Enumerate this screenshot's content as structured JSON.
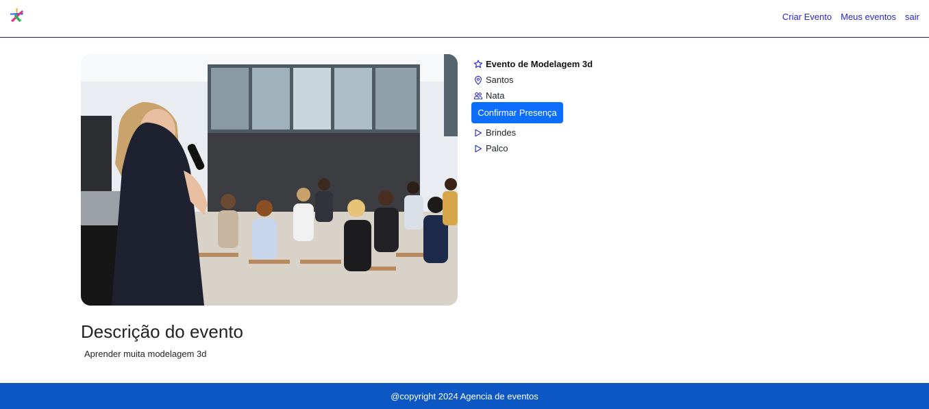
{
  "nav": {
    "links": [
      "Criar Evento",
      "Meus eventos",
      "sair"
    ]
  },
  "event": {
    "title": "Evento de Modelagem 3d",
    "location": "Santos",
    "organizer": "Nata",
    "confirm_label": "Confirmar Presença",
    "items": [
      "Brindes",
      "Palco"
    ]
  },
  "description": {
    "heading": "Descrição do evento",
    "text": "Aprender muita modelagem 3d"
  },
  "footer": {
    "text": "@copyright 2024 Agencia de eventos"
  },
  "colors": {
    "link": "#2626c9",
    "button": "#0d6efd",
    "footer": "#0c57c4"
  }
}
